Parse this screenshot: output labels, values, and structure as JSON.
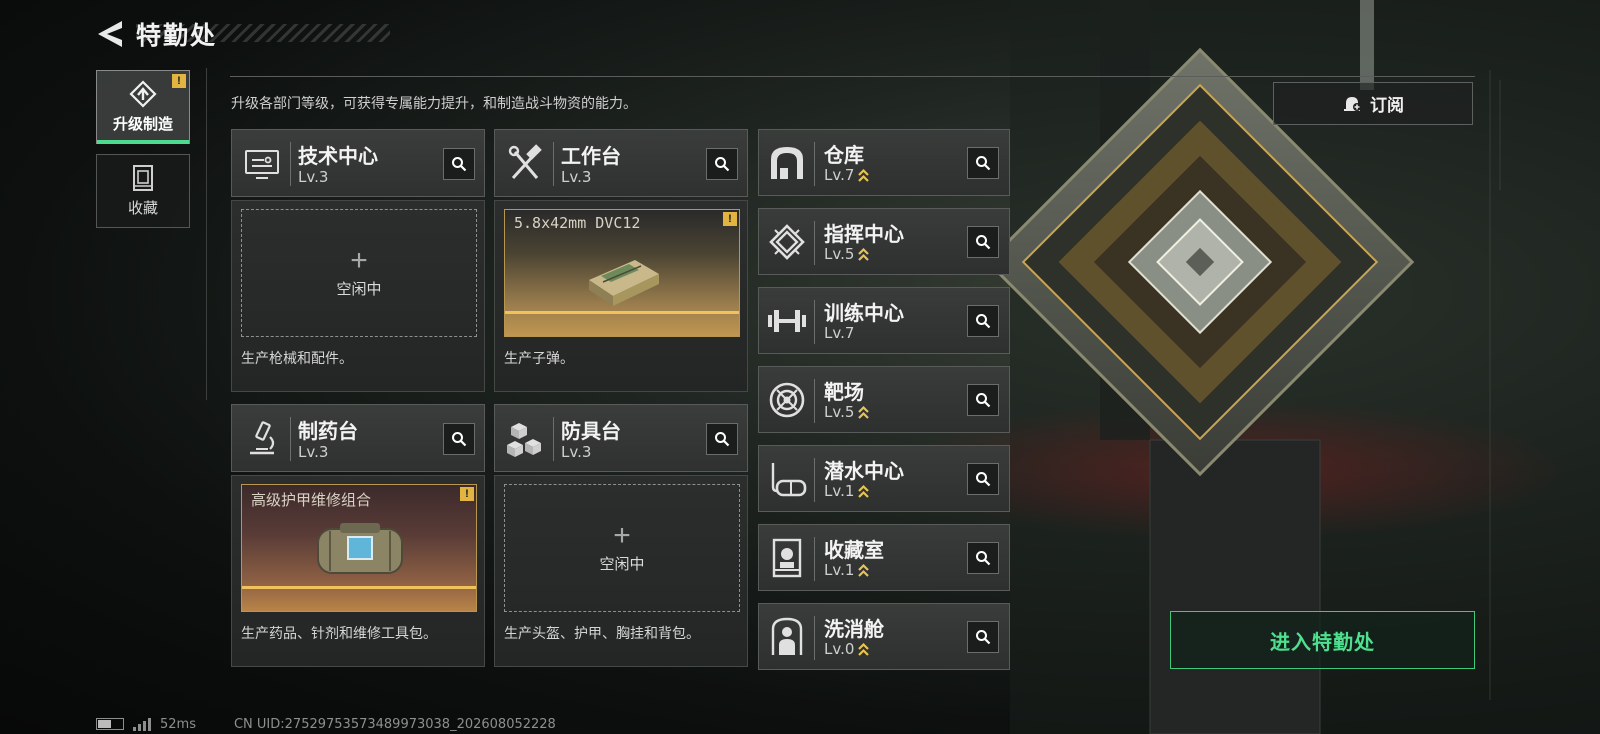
{
  "header": {
    "title": "特勤处"
  },
  "nav": [
    {
      "label": "升级制造",
      "icon": "upgrade-craft-icon",
      "active": true,
      "alert": "!"
    },
    {
      "label": "收藏",
      "icon": "collection-icon",
      "active": false
    }
  ],
  "description": "升级各部门等级，可获得专属能力提升，和制造战斗物资的能力。",
  "subscribe": {
    "label": "订阅",
    "icon": "bell-plus-icon"
  },
  "workshops": [
    {
      "name": "技术中心",
      "level": "Lv.3",
      "icon": "tech-center-icon",
      "status": "idle",
      "plus": "+",
      "idle_text": "空闲中",
      "desc": "生产枪械和配件。"
    },
    {
      "name": "工作台",
      "level": "Lv.3",
      "icon": "hammer-wrench-icon",
      "status": "producing",
      "product": "5.8x42mm DVC12",
      "product_icon": "ammo-box-icon",
      "alert": "!",
      "desc": "生产子弹。"
    },
    {
      "name": "制药台",
      "level": "Lv.3",
      "icon": "microscope-icon",
      "status": "producing",
      "product": "高级护甲维修组合",
      "product_icon": "armor-repair-kit-icon",
      "alert": "!",
      "desc": "生产药品、针剂和维修工具包。"
    },
    {
      "name": "防具台",
      "level": "Lv.3",
      "icon": "armor-blocks-icon",
      "status": "idle",
      "plus": "+",
      "idle_text": "空闲中",
      "desc": "生产头盔、护甲、胸挂和背包。"
    }
  ],
  "facilities": [
    {
      "name": "仓库",
      "level": "Lv.7",
      "icon": "warehouse-icon",
      "upgradable": true
    },
    {
      "name": "指挥中心",
      "level": "Lv.5",
      "icon": "command-center-icon",
      "upgradable": true
    },
    {
      "name": "训练中心",
      "level": "Lv.7",
      "icon": "dumbbell-icon",
      "upgradable": false
    },
    {
      "name": "靶场",
      "level": "Lv.5",
      "icon": "target-icon",
      "upgradable": true
    },
    {
      "name": "潜水中心",
      "level": "Lv.1",
      "icon": "diving-mask-icon",
      "upgradable": true
    },
    {
      "name": "收藏室",
      "level": "Lv.1",
      "icon": "display-case-icon",
      "upgradable": true
    },
    {
      "name": "洗消舱",
      "level": "Lv.0",
      "icon": "decontamination-icon",
      "upgradable": true
    }
  ],
  "enter_button": {
    "label": "进入特勤处"
  },
  "footer": {
    "ping": "52ms",
    "uid": "CN UID:2752975357348997303​8_202608052228"
  },
  "colors": {
    "accent": "#4ddc8f",
    "alert": "#e2b542",
    "product_border": "#b8964e",
    "upgrade": "#e8c255"
  }
}
